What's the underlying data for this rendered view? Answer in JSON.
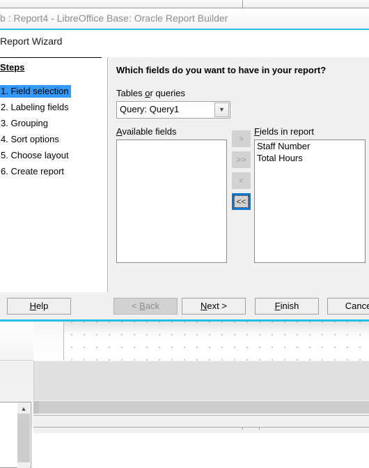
{
  "window": {
    "title": "b : Report4 - LibreOffice Base: Oracle Report Builder",
    "accent_color": "#28bfe6"
  },
  "dialog": {
    "title": "Report Wizard",
    "heading": "Which fields do you want to have in your report?"
  },
  "steps": {
    "title": "Steps",
    "items": [
      {
        "label": "1. Field selection",
        "active": true
      },
      {
        "label": "2. Labeling fields",
        "active": false
      },
      {
        "label": "3. Grouping",
        "active": false
      },
      {
        "label": "4. Sort options",
        "active": false
      },
      {
        "label": "5. Choose layout",
        "active": false
      },
      {
        "label": "6. Create report",
        "active": false
      }
    ],
    "highlight_color": "#3399ff"
  },
  "content": {
    "tables_label_pre": "Tables ",
    "tables_label_accel": "o",
    "tables_label_post": "r queries",
    "tables_value": "Query: Query1",
    "dropdown_icon": "chevron-down-icon",
    "available_label_accel": "A",
    "available_label_post": "vailable fields",
    "inreport_label_accel": "F",
    "inreport_label_post": "ields in report",
    "available_fields": [],
    "fields_in_report": [
      "Staff Number",
      "Total Hours"
    ]
  },
  "transfer_buttons": [
    {
      "name": "move-right-button",
      "label": ">",
      "enabled": false,
      "focused": false
    },
    {
      "name": "move-all-right-button",
      "label": ">>",
      "enabled": false,
      "focused": false
    },
    {
      "name": "move-left-button",
      "label": "<",
      "enabled": false,
      "focused": false
    },
    {
      "name": "move-all-left-button",
      "label": "<<",
      "enabled": true,
      "focused": true
    }
  ],
  "buttons": {
    "help_pre": "H",
    "help_accel": "H",
    "help_post": "elp",
    "back_label": "< Back",
    "back_accel": "B",
    "back_pre": "< ",
    "back_post": "ack",
    "next_accel": "N",
    "next_post": "ext >",
    "finish_accel": "F",
    "finish_post": "inish",
    "cancel_label": "Cancel"
  }
}
